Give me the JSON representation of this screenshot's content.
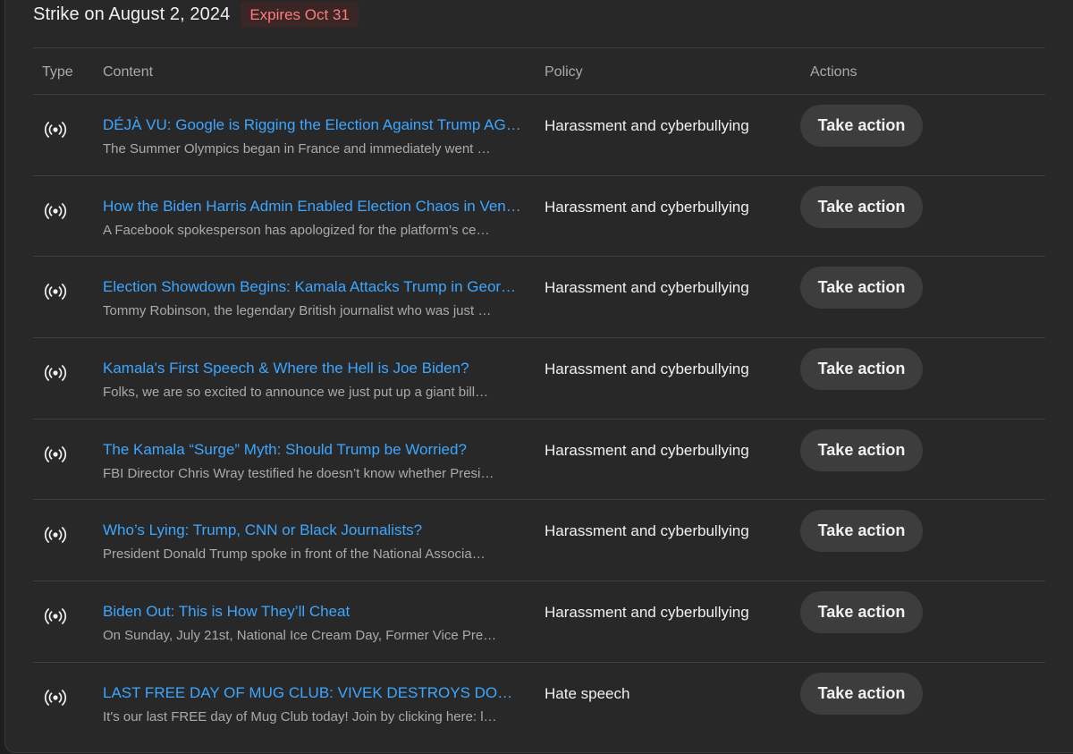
{
  "header": {
    "title": "Strike on August 2, 2024",
    "badge": "Expires Oct 31"
  },
  "table": {
    "columns": {
      "type": "Type",
      "content": "Content",
      "policy": "Policy",
      "actions": "Actions"
    },
    "rows": [
      {
        "type_icon": "live-broadcast-icon",
        "title": "DÉJÀ VU: Google is Rigging the Election Against Trump AG…",
        "description": "The Summer Olympics began in France and immediately went …",
        "policy": "Harassment and cyberbullying",
        "action": "Take action"
      },
      {
        "type_icon": "live-broadcast-icon",
        "title": "How the Biden Harris Admin Enabled Election Chaos in Ven…",
        "description": "A Facebook spokesperson has apologized for the platform’s ce…",
        "policy": "Harassment and cyberbullying",
        "action": "Take action"
      },
      {
        "type_icon": "live-broadcast-icon",
        "title": "Election Showdown Begins: Kamala Attacks Trump in Geor…",
        "description": "Tommy Robinson, the legendary British journalist who was just …",
        "policy": "Harassment and cyberbullying",
        "action": "Take action"
      },
      {
        "type_icon": "live-broadcast-icon",
        "title": "Kamala's First Speech & Where the Hell is Joe Biden?",
        "description": "Folks, we are so excited to announce we just put up a giant bill…",
        "policy": "Harassment and cyberbullying",
        "action": "Take action"
      },
      {
        "type_icon": "live-broadcast-icon",
        "title": "The Kamala “Surge” Myth: Should Trump be Worried?",
        "description": "FBI Director Chris Wray testified he doesn’t know whether Presi…",
        "policy": "Harassment and cyberbullying",
        "action": "Take action"
      },
      {
        "type_icon": "live-broadcast-icon",
        "title": "Who’s Lying: Trump, CNN or Black Journalists?",
        "description": "President Donald Trump spoke in front of the National Associa…",
        "policy": "Harassment and cyberbullying",
        "action": "Take action"
      },
      {
        "type_icon": "live-broadcast-icon",
        "title": "Biden Out: This is How They’ll Cheat",
        "description": "On Sunday, July 21st, National Ice Cream Day, Former Vice Pre…",
        "policy": "Harassment and cyberbullying",
        "action": "Take action"
      },
      {
        "type_icon": "live-broadcast-icon",
        "title": "LAST FREE DAY OF MUG CLUB: VIVEK DESTROYS DON LE…",
        "description": "It's our last FREE day of Mug Club today! Join by clicking here: l…",
        "policy": "Hate speech",
        "action": "Take action"
      }
    ]
  },
  "colors": {
    "background": "#282828",
    "link": "#3ea6ff",
    "badge_text": "#ff7b7b",
    "badge_bg": "#3b2626",
    "button_bg": "#3d3d3d"
  }
}
